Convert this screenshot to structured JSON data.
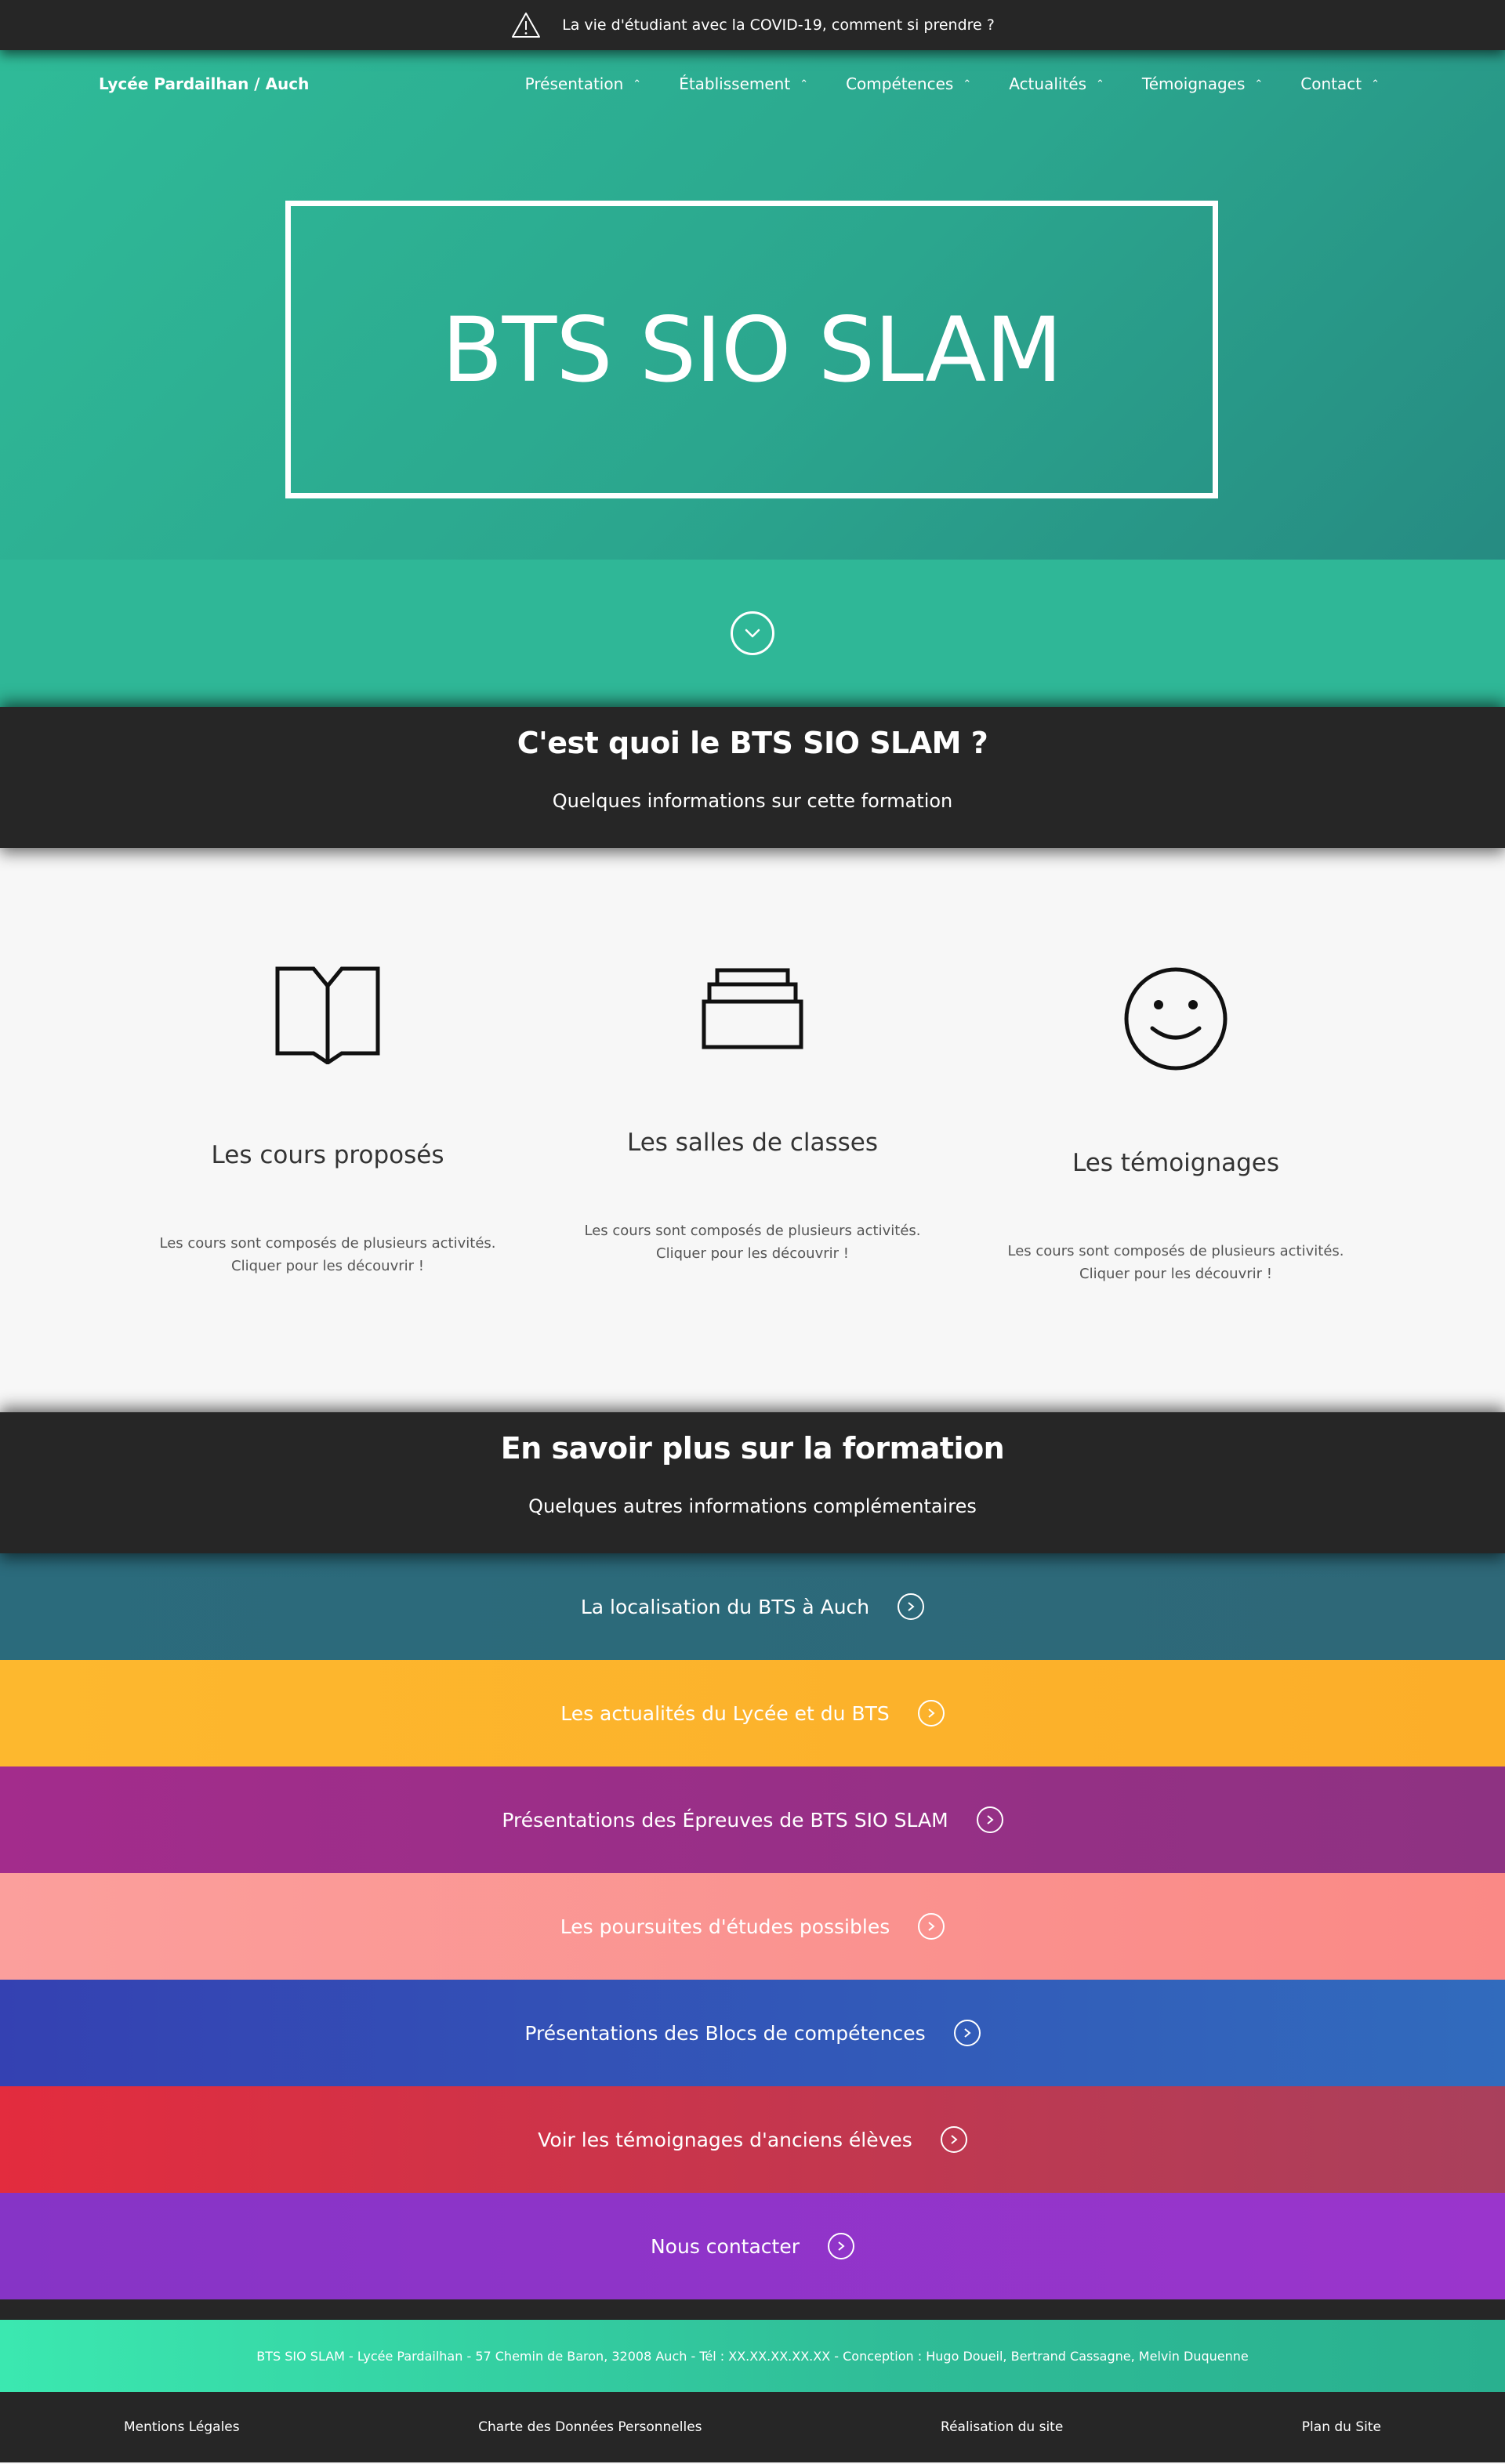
{
  "top_banner": {
    "text": "La vie d'étudiant avec la COVID-19, comment si prendre ?",
    "icon": "warning-triangle-icon"
  },
  "nav": {
    "brand": "Lycée Pardailhan / Auch",
    "items": [
      {
        "label": "Présentation",
        "id": "presentation"
      },
      {
        "label": "Établissement",
        "id": "etablissement"
      },
      {
        "label": "Compétences",
        "id": "competences"
      },
      {
        "label": "Actualités",
        "id": "actualites"
      },
      {
        "label": "Témoignages",
        "id": "temoignages"
      },
      {
        "label": "Contact",
        "id": "contact"
      }
    ],
    "caret": "⌃"
  },
  "hero": {
    "title": "BTS SIO SLAM"
  },
  "section1": {
    "title": "C'est quoi le BTS SIO SLAM ?",
    "subtitle": "Quelques informations sur cette formation"
  },
  "features": [
    {
      "icon": "book-icon",
      "title": "Les cours proposés",
      "line1": "Les cours sont composés de plusieurs activités.",
      "line2": "Cliquer pour les découvrir !"
    },
    {
      "icon": "stacked-drawers-icon",
      "title": "Les salles de classes",
      "line1": "Les cours sont composés de plusieurs activités.",
      "line2": "Cliquer pour les découvrir !"
    },
    {
      "icon": "smiley-face-icon",
      "title": "Les témoignages",
      "line1": "Les cours sont composés de plusieurs activités.",
      "line2": "Cliquer pour les découvrir !"
    }
  ],
  "section2": {
    "title": "En savoir plus sur la formation",
    "subtitle": "Quelques autres informations complémentaires"
  },
  "links": [
    {
      "label": "La localisation du BTS à Auch",
      "color": "#2b6b7c"
    },
    {
      "label": "Les actualités du Lycée et du BTS",
      "color": "#fbb52c"
    },
    {
      "label": "Présentations des Épreuves de BTS SIO SLAM",
      "color": "#9c2e8c"
    },
    {
      "label": "Les poursuites d'études possibles",
      "color": "#fa9a96"
    },
    {
      "label": "Présentations des Blocs de compétences",
      "color": "#3447b4"
    },
    {
      "label": "Voir les témoignages d'anciens élèves",
      "color": "#d93042"
    },
    {
      "label": "Nous contacter",
      "color": "#8b34c8"
    }
  ],
  "footer": {
    "info": "BTS SIO SLAM - Lycée Pardailhan - 57 Chemin de Baron, 32008 Auch - Tél : XX.XX.XX.XX.XX - Conception : Hugo Doueil, Bertrand Cassagne, Melvin Duquenne",
    "links": [
      "Mentions Légales",
      "Charte des Données Personnelles",
      "Réalisation du site",
      "Plan du Site"
    ]
  }
}
